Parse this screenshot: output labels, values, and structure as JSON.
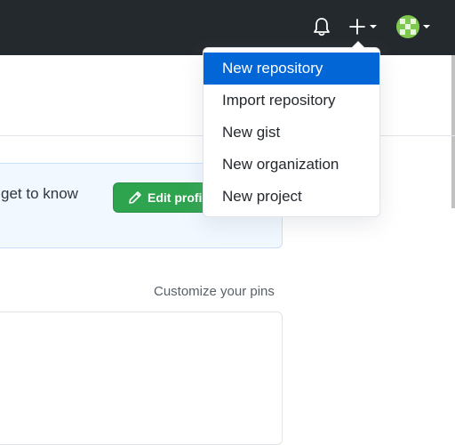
{
  "header": {
    "icons": {
      "notifications": "bell-icon",
      "create": "plus-icon",
      "avatar": "identicon-avatar"
    }
  },
  "welcome_banner": {
    "text": "get to know",
    "edit_button_label": "Edit profi"
  },
  "pins": {
    "customize_label": "Customize your pins"
  },
  "create_menu": {
    "items": [
      {
        "label": "New repository",
        "active": true
      },
      {
        "label": "Import repository"
      },
      {
        "label": "New gist"
      },
      {
        "label": "New organization"
      },
      {
        "label": "New project"
      }
    ]
  },
  "colors": {
    "header_bg": "#24292e",
    "menu_active_bg": "#0366d6",
    "edit_button_bg": "#2ea44f",
    "banner_bg": "#f1f8ff"
  }
}
